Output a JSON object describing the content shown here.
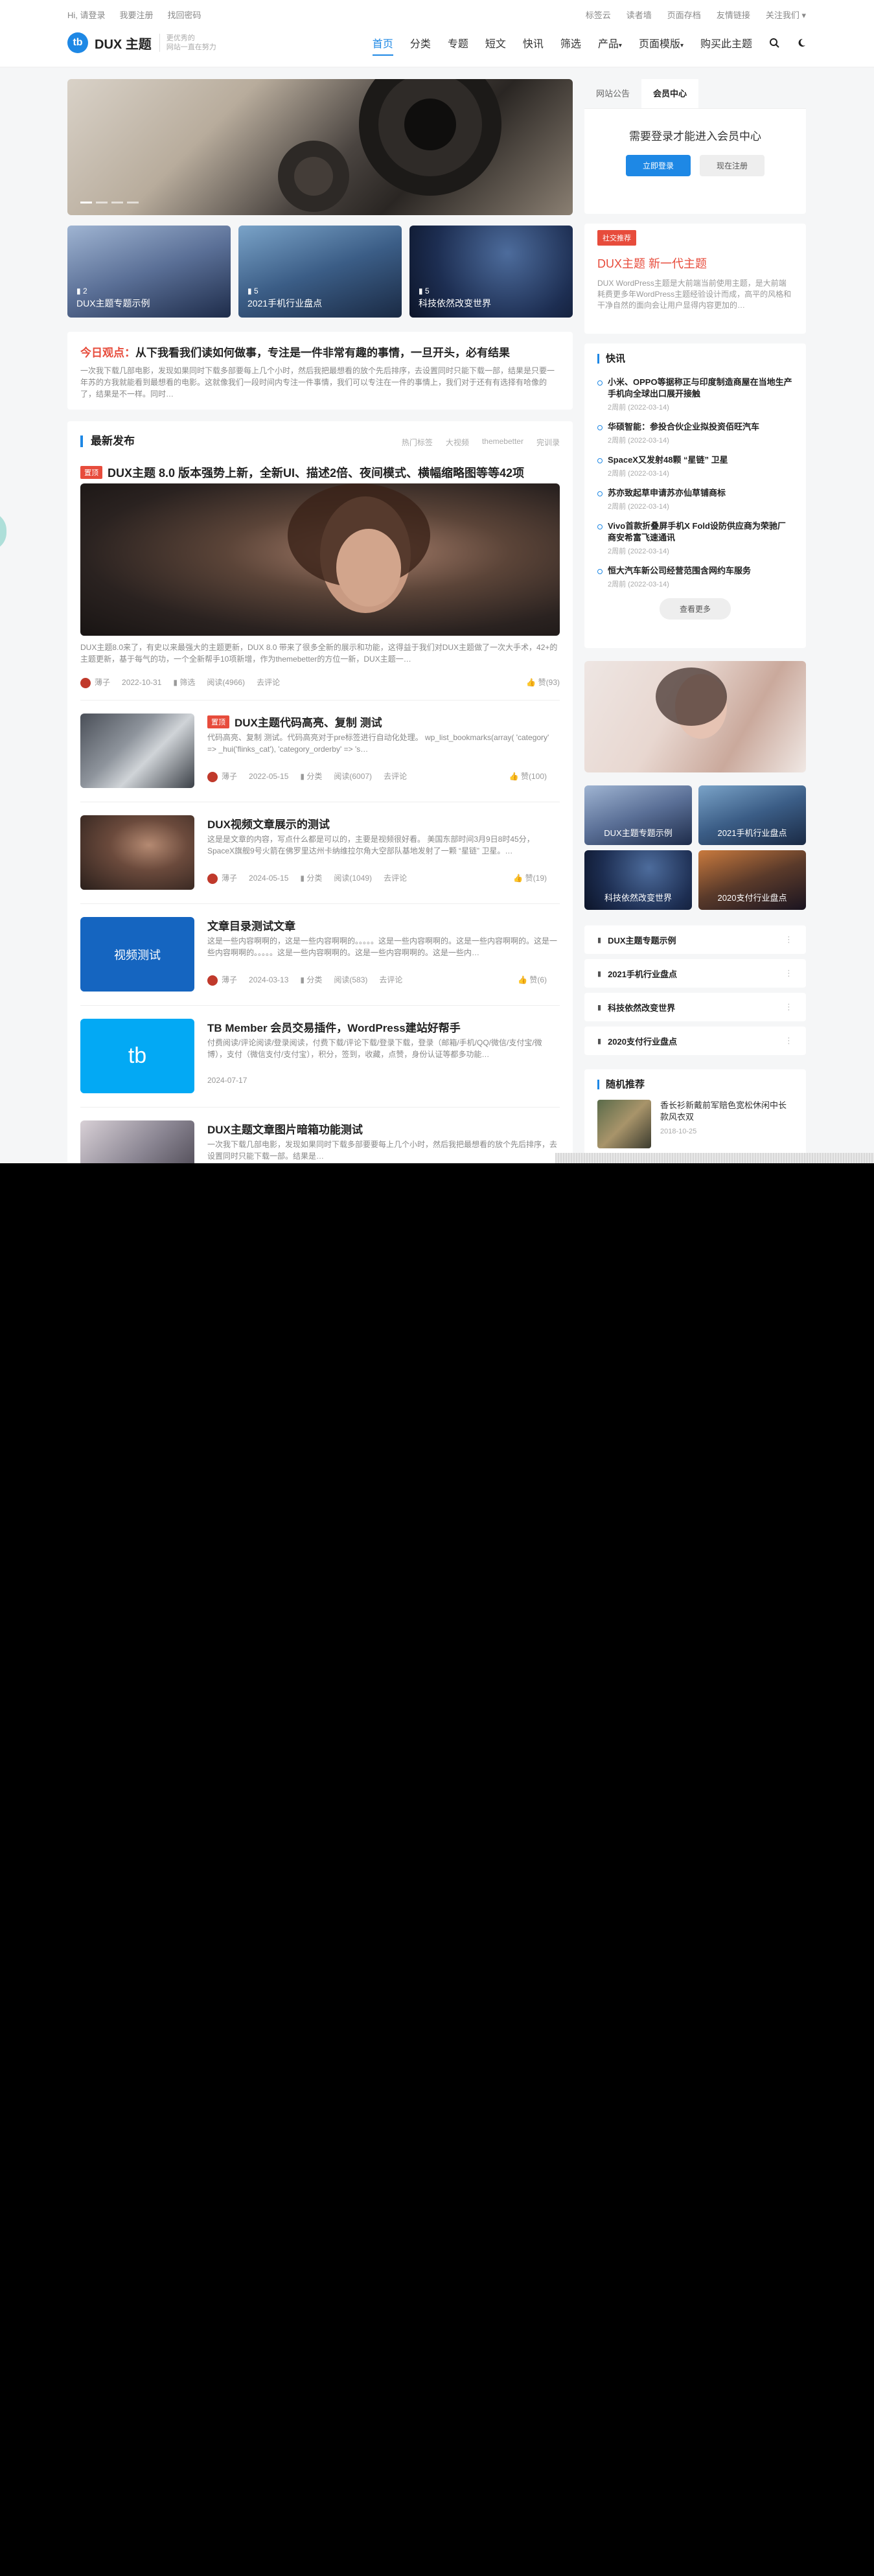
{
  "topbar": {
    "greeting": "Hi, 请登录",
    "register": "我要注册",
    "forgot": "找回密码",
    "links": [
      "标签云",
      "读者墙",
      "页面存档",
      "友情链接",
      "关注我们"
    ]
  },
  "header": {
    "logo_mark": "tb",
    "site_name": "DUX 主题",
    "slogan_1": "更优秀的",
    "slogan_2": "网站一直在努力",
    "nav": [
      "首页",
      "分类",
      "专题",
      "短文",
      "快讯",
      "筛选",
      "产品",
      "页面模版",
      "购买此主题"
    ]
  },
  "slider": {
    "dots": 4,
    "active": 0
  },
  "topics": [
    {
      "count": "2",
      "label": "DUX主题专题示例"
    },
    {
      "count": "5",
      "label": "2021手机行业盘点"
    },
    {
      "count": "5",
      "label": "科技依然改变世界"
    }
  ],
  "notice": {
    "prefix": "今日观点：",
    "title": "从下我看我们读如何做事，专注是一件非常有趣的事情，一旦开头，必有结果",
    "desc": "一次我下载几部电影，发现如果同时下载多部要每上几个小时，然后我把最想看的放个先后排序，去设置同时只能下载一部，结果是只要一年苏的方我就能看到最想看的电影。这就像我们一段时间内专注一件事情，我们可以专注在一件的事情上，我们对于还有有选择有哈像的了，结果是不一样。同时…"
  },
  "latest": {
    "heading": "最新发布",
    "tags": [
      "热门标签",
      "大视频",
      "themebetter",
      "完训录"
    ],
    "featured": {
      "badge": "置顶",
      "title": "DUX主题 8.0 版本强势上新，全新UI、描述2倍、夜间模式、横幅缩略图等等42项",
      "desc": "DUX主题8.0来了，有史以来最强大的主题更新，DUX 8.0 带来了很多全新的展示和功能，这得益于我们对DUX主题做了一次大手术，42+的主题更新，基于每气的功，一个全新帮手10项新增，作为themebetter的方位一新，DUX主题一…",
      "author": "薄子",
      "date": "2022-10-31",
      "cat": "筛选",
      "views": "阅读(4966)",
      "comments": "去评论",
      "likes": "赞(93)"
    },
    "items": [
      {
        "badge": "置顶",
        "title": "DUX主题代码高亮、复制 测试",
        "desc": "代码高亮、复制 测试。代码高亮对于pre标签进行自动化处理。 wp_list_bookmarks(array( 'category' => _hui('flinks_cat'), 'category_orderby' => 's…",
        "author": "薄子",
        "date": "2022-05-15",
        "cat": "分类",
        "views": "阅读(6007)",
        "comments": "去评论",
        "likes": "赞(100)"
      },
      {
        "badge": "",
        "title": "DUX视频文章展示的测试",
        "desc": "这是是文章的内容，写点什么都是可以的，主要是视频很好看。 美国东部时间3月9日8时45分，SpaceX旗舰9号火箭在佛罗里达州卡纳维拉尔角大空部队基地发射了一颗 “星链” 卫星。…",
        "author": "薄子",
        "date": "2024-05-15",
        "cat": "分类",
        "views": "阅读(1049)",
        "comments": "去评论",
        "likes": "赞(19)"
      },
      {
        "badge": "",
        "title": "文章目录测试文章",
        "desc": "这是一些内容啊啊的，这是一些内容啊啊的。。。。。这是一些内容啊啊的。这是一些内容啊啊的。这是一些内容啊啊的。。。。。这是一些内容啊啊的。这是一些内容啊啊的。这是一些内…",
        "author": "薄子",
        "date": "2024-03-13",
        "cat": "分类",
        "views": "阅读(583)",
        "comments": "去评论",
        "likes": "赞(6)"
      },
      {
        "badge": "",
        "title": "TB Member 会员交易插件，WordPress建站好帮手",
        "desc": "付费阅读/评论阅读/登录阅读，付费下载/评论下载/登录下载，登录（邮箱/手机/QQ/微信/支付宝/微博），支付（微信支付/支付宝），积分，签到，收藏，点赞，身份认证等都多功能…",
        "author": "",
        "date": "2024-07-17",
        "cat": "",
        "views": "",
        "comments": "",
        "likes": ""
      },
      {
        "badge": "",
        "title": "DUX主题文章图片暗箱功能测试",
        "desc": "一次我下载几部电影，发现如果同时下载多部要要每上几个小时，然后我把最想看的放个先后排序，去设置同时只能下载一部。结果是…",
        "author": "",
        "date": "",
        "cat": "",
        "views": "",
        "comments": "",
        "likes": ""
      }
    ],
    "thumb_texts": [
      "",
      "",
      "视频测试",
      "tb",
      ""
    ]
  },
  "sidebar": {
    "login": {
      "tabs": [
        "网站公告",
        "会员中心"
      ],
      "message": "需要登录才能进入会员中心",
      "login_btn": "立即登录",
      "reg_btn": "现在注册"
    },
    "ad": {
      "tag": "社交推荐",
      "title": "DUX主题 新一代主题",
      "desc": "DUX WordPress主题是大前端当前使用主题，是大前端耗费更多年WordPress主题经验设计而成，高平的风格和干净自然的面向会让用户显得内容更加的…"
    },
    "news": {
      "heading": "快讯",
      "items": [
        {
          "title": "小米、OPPO等据称正与印度制造商屋在当地生产手机向全球出口展开接触",
          "date": "2周前 (2022-03-14)"
        },
        {
          "title": "华硕智能：参投合伙企业拟投资佰旺汽车",
          "date": "2周前 (2022-03-14)"
        },
        {
          "title": "SpaceX又发射48颗 “星链” 卫星",
          "date": "2周前 (2022-03-14)"
        },
        {
          "title": "苏亦致起草申请苏亦仙草铺商标",
          "date": "2周前 (2022-03-14)"
        },
        {
          "title": "Vivo首款折叠屏手机X Fold设防供应商为荣驰厂商安希富飞速通讯",
          "date": "2周前 (2022-03-14)"
        },
        {
          "title": "恒大汽车新公司经营范围含网约车服务",
          "date": "2周前 (2022-03-14)"
        }
      ],
      "more": "查看更多"
    },
    "topic_grid": [
      "DUX主题专题示例",
      "2021手机行业盘点",
      "科技依然改变世界",
      "2020支付行业盘点"
    ],
    "topic_links": [
      "DUX主题专题示例",
      "2021手机行业盘点",
      "科技依然改变世界",
      "2020支付行业盘点"
    ],
    "recommend": {
      "heading": "随机推荐",
      "title": "香长衫新戴前军赔色宽松休闲中长款风衣双",
      "date": "2018-10-25"
    }
  },
  "colors": {
    "accent": "#1e88e5",
    "red": "#e74c3c"
  }
}
